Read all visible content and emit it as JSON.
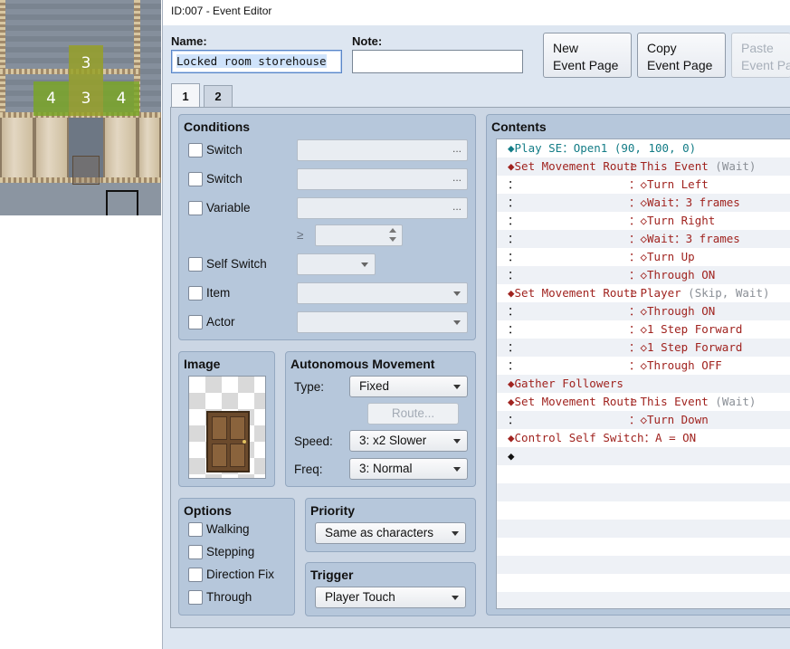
{
  "window": {
    "title": "ID:007 - Event Editor"
  },
  "map": {
    "tiles": [
      {
        "name": "map-route-tile-top",
        "label": "3"
      },
      {
        "name": "map-route-tile-left",
        "label": "4"
      },
      {
        "name": "map-route-tile-center",
        "label": "3"
      },
      {
        "name": "map-route-tile-right",
        "label": "4"
      }
    ]
  },
  "header": {
    "name_label": "Name:",
    "name_value": "Locked room storehouse",
    "note_label": "Note:",
    "note_value": "",
    "new_page_line1": "New",
    "new_page_line2": "Event Page",
    "copy_page_line1": "Copy",
    "copy_page_line2": "Event Page",
    "paste_page_line1": "Paste",
    "paste_page_line2": "Event Pa"
  },
  "tabs": [
    "1",
    "2"
  ],
  "conditions": {
    "title": "Conditions",
    "switch1": "Switch",
    "switch2": "Switch",
    "variable": "Variable",
    "ge": "≥",
    "self_switch": "Self Switch",
    "item": "Item",
    "actor": "Actor",
    "dots": "..."
  },
  "image": {
    "title": "Image"
  },
  "autonomous": {
    "title": "Autonomous Movement",
    "type_label": "Type:",
    "type_value": "Fixed",
    "route_button": "Route...",
    "speed_label": "Speed:",
    "speed_value": "3: x2 Slower",
    "freq_label": "Freq:",
    "freq_value": "3: Normal"
  },
  "options": {
    "title": "Options",
    "walking": "Walking",
    "stepping": "Stepping",
    "direction_fix": "Direction Fix",
    "through": "Through"
  },
  "priority": {
    "title": "Priority",
    "value": "Same as characters"
  },
  "trigger": {
    "title": "Trigger",
    "value": "Player Touch"
  },
  "contents": {
    "title": "Contents",
    "rows": [
      {
        "col1": "◆Play SE：Open1 (90, 100, 0)",
        "col1_color": "#137c86",
        "col2": "",
        "col2_color": "",
        "col2_extra": ""
      },
      {
        "col1": "◆Set Movement Route",
        "col1_color": "#a0231f",
        "col2": "：This Event",
        "col2_color": "#a0231f",
        "col2_extra": " (Wait)"
      },
      {
        "col1": "：",
        "col1_color": "#111111",
        "col2": "：◇Turn Left",
        "col2_color": "#a0231f",
        "col2_extra": ""
      },
      {
        "col1": "：",
        "col1_color": "#111111",
        "col2": "：◇Wait：3 frames",
        "col2_color": "#a0231f",
        "col2_extra": ""
      },
      {
        "col1": "：",
        "col1_color": "#111111",
        "col2": "：◇Turn Right",
        "col2_color": "#a0231f",
        "col2_extra": ""
      },
      {
        "col1": "：",
        "col1_color": "#111111",
        "col2": "：◇Wait：3 frames",
        "col2_color": "#a0231f",
        "col2_extra": ""
      },
      {
        "col1": "：",
        "col1_color": "#111111",
        "col2": "：◇Turn Up",
        "col2_color": "#a0231f",
        "col2_extra": ""
      },
      {
        "col1": "：",
        "col1_color": "#111111",
        "col2": "：◇Through ON",
        "col2_color": "#a0231f",
        "col2_extra": ""
      },
      {
        "col1": "◆Set Movement Route",
        "col1_color": "#a0231f",
        "col2": "：Player",
        "col2_color": "#a0231f",
        "col2_extra": " (Skip, Wait)"
      },
      {
        "col1": "：",
        "col1_color": "#111111",
        "col2": "：◇Through ON",
        "col2_color": "#a0231f",
        "col2_extra": ""
      },
      {
        "col1": "：",
        "col1_color": "#111111",
        "col2": "：◇1 Step Forward",
        "col2_color": "#a0231f",
        "col2_extra": ""
      },
      {
        "col1": "：",
        "col1_color": "#111111",
        "col2": "：◇1 Step Forward",
        "col2_color": "#a0231f",
        "col2_extra": ""
      },
      {
        "col1": "：",
        "col1_color": "#111111",
        "col2": "：◇Through OFF",
        "col2_color": "#a0231f",
        "col2_extra": ""
      },
      {
        "col1": "◆Gather Followers",
        "col1_color": "#a0231f",
        "col2": "",
        "col2_color": "",
        "col2_extra": ""
      },
      {
        "col1": "◆Set Movement Route",
        "col1_color": "#a0231f",
        "col2": "：This Event",
        "col2_color": "#a0231f",
        "col2_extra": " (Wait)"
      },
      {
        "col1": "：",
        "col1_color": "#111111",
        "col2": "：◇Turn Down",
        "col2_color": "#a0231f",
        "col2_extra": ""
      },
      {
        "col1": "◆Control Self Switch：A = ON",
        "col1_color": "#a0231f",
        "col2": "",
        "col2_color": "",
        "col2_extra": ""
      },
      {
        "col1": "◆",
        "col1_color": "#111111",
        "col2": "",
        "col2_color": "",
        "col2_extra": ""
      },
      {
        "col1": "",
        "col1_color": "",
        "col2": "",
        "col2_color": "",
        "col2_extra": ""
      },
      {
        "col1": "",
        "col1_color": "",
        "col2": "",
        "col2_color": "",
        "col2_extra": ""
      },
      {
        "col1": "",
        "col1_color": "",
        "col2": "",
        "col2_color": "",
        "col2_extra": ""
      },
      {
        "col1": "",
        "col1_color": "",
        "col2": "",
        "col2_color": "",
        "col2_extra": ""
      },
      {
        "col1": "",
        "col1_color": "",
        "col2": "",
        "col2_color": "",
        "col2_extra": ""
      },
      {
        "col1": "",
        "col1_color": "",
        "col2": "",
        "col2_color": "",
        "col2_extra": ""
      },
      {
        "col1": "",
        "col1_color": "",
        "col2": "",
        "col2_color": "",
        "col2_extra": ""
      },
      {
        "col1": "",
        "col1_color": "",
        "col2": "",
        "col2_color": "",
        "col2_extra": ""
      }
    ]
  }
}
